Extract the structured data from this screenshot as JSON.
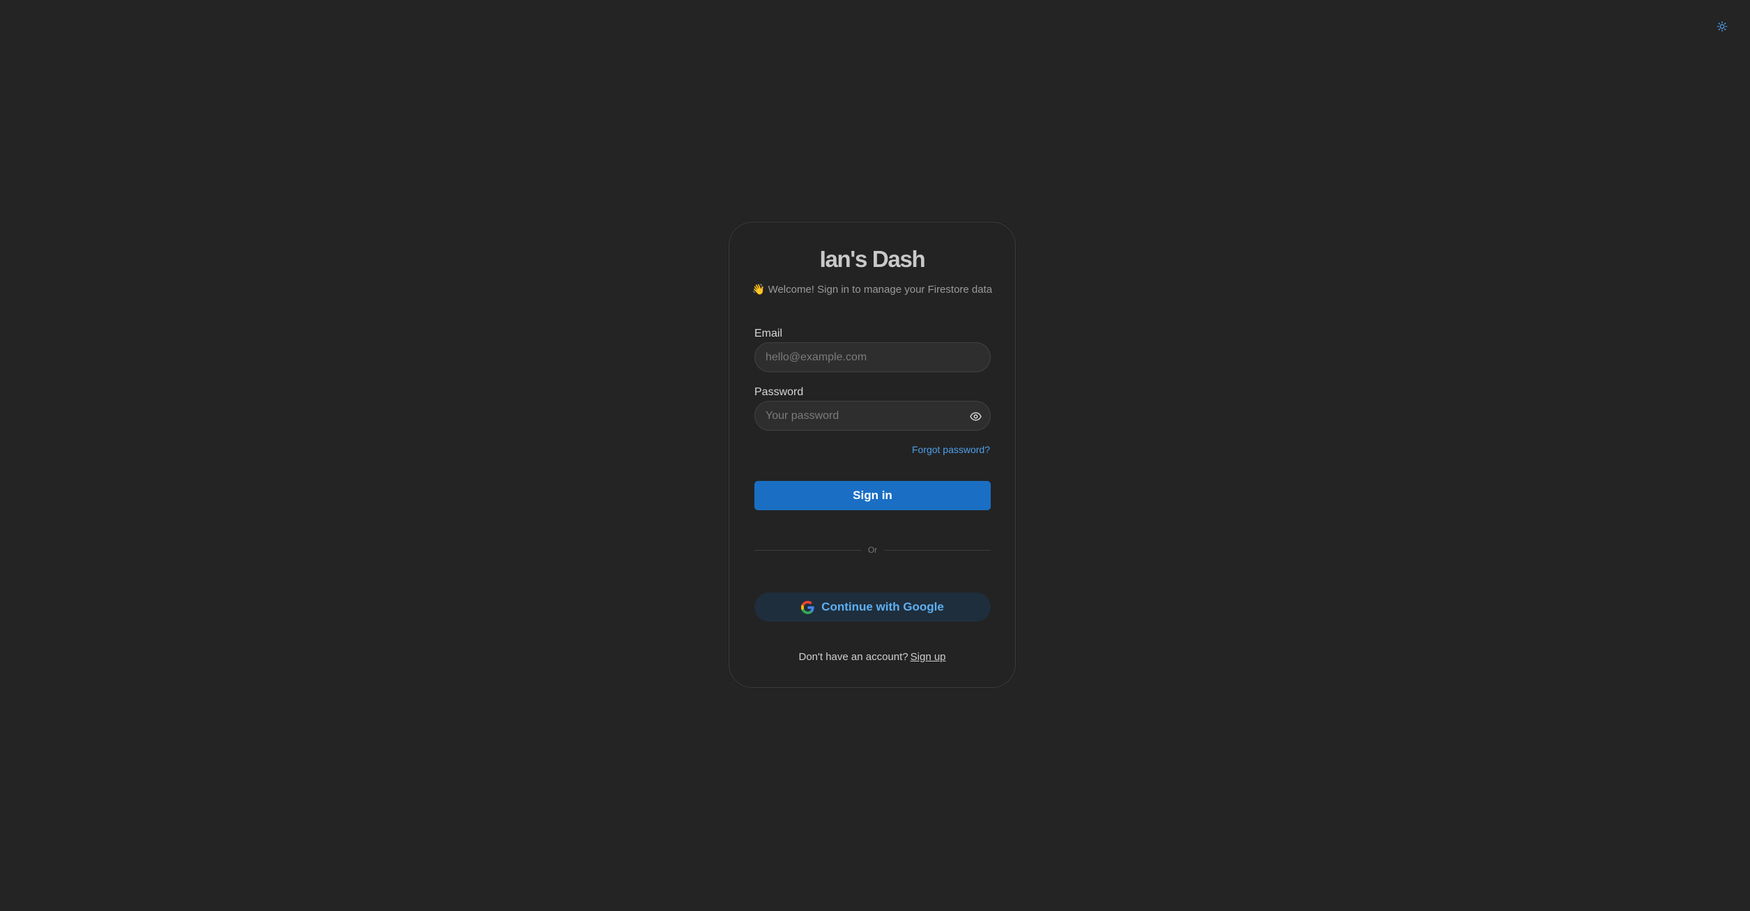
{
  "app": {
    "title": "Ian's Dash",
    "subtitle_emoji": "👋",
    "subtitle": "Welcome! Sign in to manage your Firestore data"
  },
  "theme_toggle": {
    "icon": "sun-icon",
    "color": "#4d9fe8"
  },
  "form": {
    "email": {
      "label": "Email",
      "placeholder": "hello@example.com",
      "value": ""
    },
    "password": {
      "label": "Password",
      "placeholder": "Your password",
      "value": "",
      "toggle_icon": "eye-icon"
    },
    "forgot_password": "Forgot password?",
    "submit_label": "Sign in",
    "divider_text": "Or",
    "google_label": "Continue with Google",
    "google_icon": "google-logo-icon"
  },
  "footer": {
    "prompt": "Don't have an account?",
    "signup_link": "Sign up"
  },
  "colors": {
    "background": "#242424",
    "card": "#232323",
    "primary": "#1a6fc4",
    "link": "#4d9fe8",
    "google_button_bg": "#1f2e3c",
    "google_button_text": "#5eb0f2"
  }
}
